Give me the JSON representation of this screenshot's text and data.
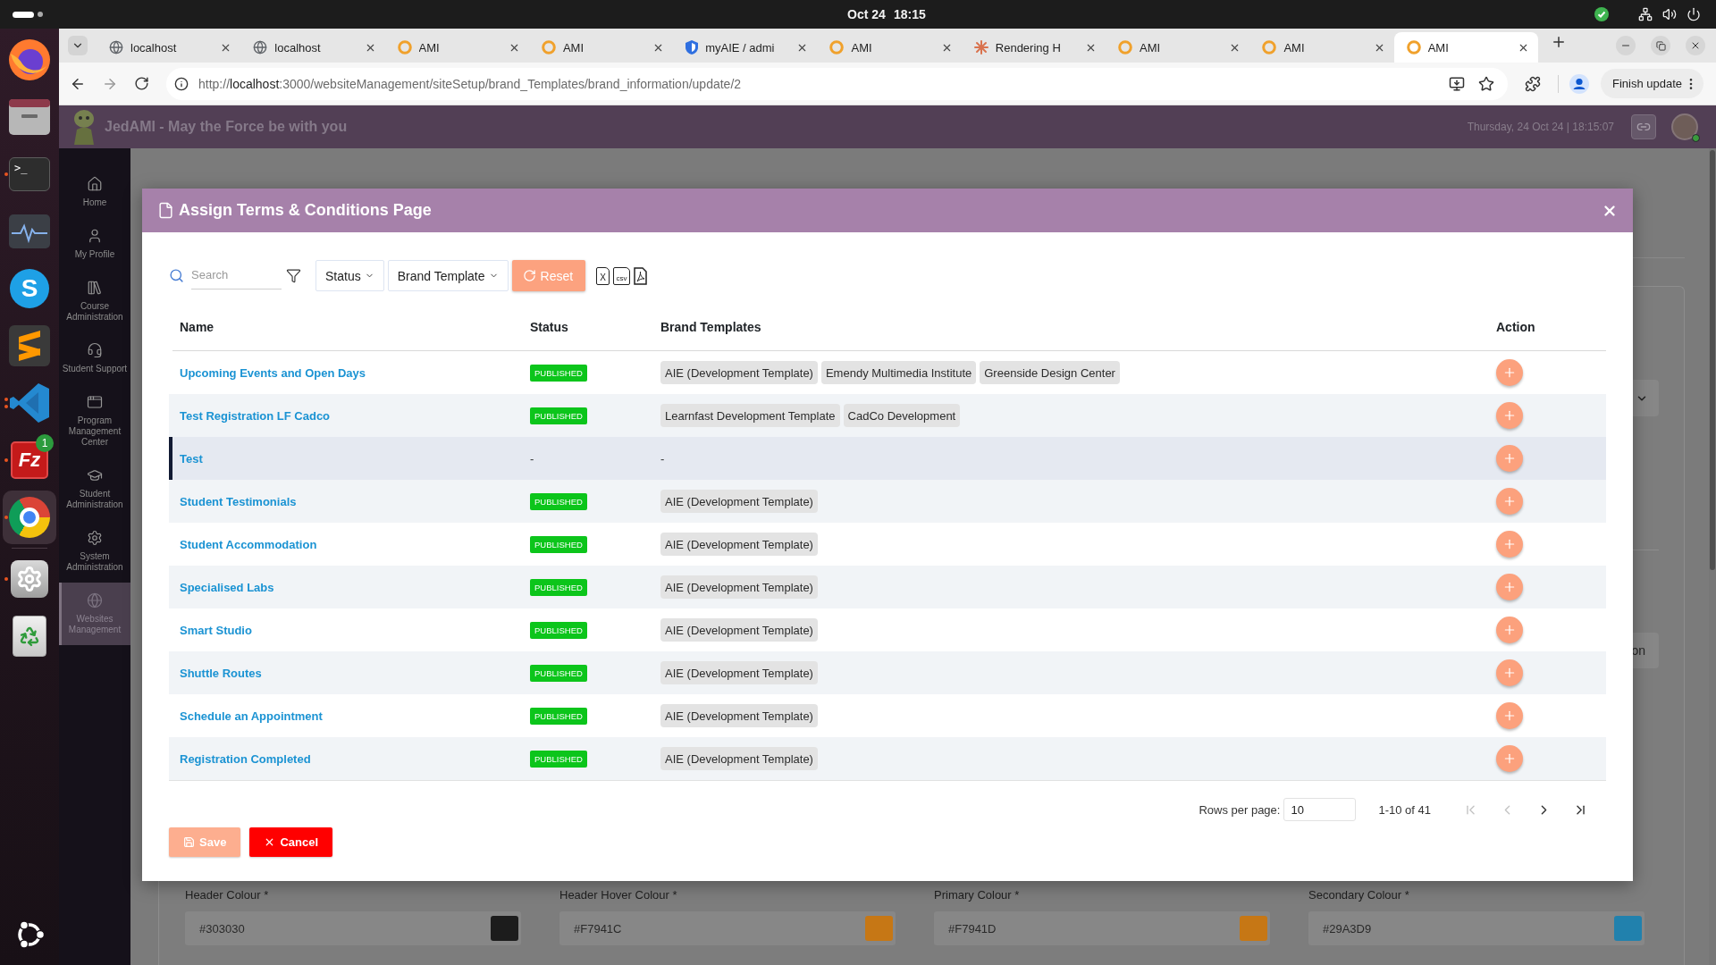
{
  "system_bar": {
    "date": "Oct 24",
    "time": "18:15"
  },
  "dock": {
    "apps": [
      {
        "running": false,
        "multi_window": false,
        "selected": false
      },
      {
        "running": false,
        "multi_window": false,
        "selected": false
      },
      {
        "glyph": ">_",
        "running": true,
        "multi_window": false,
        "selected": false
      },
      {
        "running": false,
        "multi_window": false,
        "selected": false
      },
      {
        "glyph": "S",
        "running": false,
        "multi_window": false,
        "selected": false
      },
      {
        "running": false,
        "multi_window": false,
        "selected": false
      },
      {
        "running": true,
        "multi_window": true,
        "selected": false
      },
      {
        "glyph": "Fz",
        "badge": "1",
        "running": true,
        "multi_window": false,
        "selected": false
      },
      {
        "running": true,
        "multi_window": false,
        "selected": true
      },
      {
        "running": true,
        "multi_window": false,
        "selected": false
      },
      {
        "running": false,
        "multi_window": false,
        "selected": false
      }
    ]
  },
  "browser": {
    "tabs": [
      {
        "title": "localhost",
        "selected": false
      },
      {
        "title": "localhost",
        "selected": false
      },
      {
        "title": "AMI",
        "selected": false
      },
      {
        "title": "AMI",
        "selected": false
      },
      {
        "title": "myAIE / admi",
        "selected": false
      },
      {
        "title": "AMI",
        "selected": false
      },
      {
        "title": "Rendering H",
        "selected": false
      },
      {
        "title": "AMI",
        "selected": false
      },
      {
        "title": "AMI",
        "selected": false
      },
      {
        "title": "AMI",
        "selected": true
      }
    ],
    "url": {
      "scheme": "http://",
      "host": "localhost",
      "path": ":3000/websiteManagement/siteSetup/brand_Templates/brand_information/update/2"
    },
    "update_button": "Finish update"
  },
  "app_header": {
    "title": "JedAMI - May the Force be with you",
    "datetime": "Thursday, 24 Oct 24 | 18:15:07"
  },
  "sidebar": {
    "items": [
      {
        "label": "Home",
        "selected": false
      },
      {
        "label": "My Profile",
        "selected": false
      },
      {
        "label": "Course Administration",
        "selected": false
      },
      {
        "label": "Student Support",
        "selected": false
      },
      {
        "label": "Program Management Center",
        "selected": false
      },
      {
        "label": "Student Administration",
        "selected": false
      },
      {
        "label": "System Administration",
        "selected": false
      },
      {
        "label": "Websites Management",
        "selected": true
      }
    ]
  },
  "dialog": {
    "title": "Assign Terms & Conditions Page",
    "toolbar": {
      "search": {
        "placeholder": "Search"
      },
      "filters": [
        "Status",
        "Brand Template"
      ],
      "reset": "Reset",
      "exports": [
        {
          "kind": "xls",
          "glyph": "X"
        },
        {
          "kind": "csv",
          "glyph": "csv"
        },
        {
          "kind": "pdf"
        }
      ]
    },
    "table": {
      "columns": [
        "Name",
        "Status",
        "Brand Templates",
        "Action"
      ],
      "rows": [
        {
          "name": "Upcoming Events and Open Days",
          "status": {
            "kind": "badge",
            "text": "PUBLISHED"
          },
          "brand_templates": {
            "kind": "chips",
            "items": [
              "AIE (Development Template)",
              "Emendy Multimedia Institute",
              "Greenside Design Center"
            ]
          },
          "selected": false
        },
        {
          "name": "Test Registration LF Cadco",
          "status": {
            "kind": "badge",
            "text": "PUBLISHED"
          },
          "brand_templates": {
            "kind": "chips",
            "items": [
              "Learnfast Development Template",
              "CadCo Development"
            ]
          },
          "selected": false
        },
        {
          "name": "Test",
          "status": {
            "kind": "text",
            "text": "-"
          },
          "brand_templates": {
            "kind": "text",
            "text": "-"
          },
          "selected": true
        },
        {
          "name": "Student Testimonials",
          "status": {
            "kind": "badge",
            "text": "PUBLISHED"
          },
          "brand_templates": {
            "kind": "chips",
            "items": [
              "AIE (Development Template)"
            ]
          },
          "selected": false
        },
        {
          "name": "Student Accommodation",
          "status": {
            "kind": "badge",
            "text": "PUBLISHED"
          },
          "brand_templates": {
            "kind": "chips",
            "items": [
              "AIE (Development Template)"
            ]
          },
          "selected": false
        },
        {
          "name": "Specialised Labs",
          "status": {
            "kind": "badge",
            "text": "PUBLISHED"
          },
          "brand_templates": {
            "kind": "chips",
            "items": [
              "AIE (Development Template)"
            ]
          },
          "selected": false
        },
        {
          "name": "Smart Studio",
          "status": {
            "kind": "badge",
            "text": "PUBLISHED"
          },
          "brand_templates": {
            "kind": "chips",
            "items": [
              "AIE (Development Template)"
            ]
          },
          "selected": false
        },
        {
          "name": "Shuttle Routes",
          "status": {
            "kind": "badge",
            "text": "PUBLISHED"
          },
          "brand_templates": {
            "kind": "chips",
            "items": [
              "AIE (Development Template)"
            ]
          },
          "selected": false
        },
        {
          "name": "Schedule an Appointment",
          "status": {
            "kind": "badge",
            "text": "PUBLISHED"
          },
          "brand_templates": {
            "kind": "chips",
            "items": [
              "AIE (Development Template)"
            ]
          },
          "selected": false
        },
        {
          "name": "Registration Completed",
          "status": {
            "kind": "badge",
            "text": "PUBLISHED"
          },
          "brand_templates": {
            "kind": "chips",
            "items": [
              "AIE (Development Template)"
            ]
          },
          "selected": false
        }
      ]
    },
    "pagination": {
      "rows_per_page_label": "Rows per page:",
      "rows_per_page": "10",
      "range": "1-10 of 41",
      "nav": [
        {
          "kind": "first",
          "disabled": true
        },
        {
          "kind": "prev",
          "disabled": true
        },
        {
          "kind": "next",
          "disabled": false
        },
        {
          "kind": "last",
          "disabled": false
        }
      ]
    },
    "buttons": [
      {
        "kind": "save",
        "label": "Save",
        "disabled": true
      },
      {
        "kind": "cancel",
        "label": "Cancel",
        "disabled": false
      }
    ]
  },
  "page": {
    "partial_button": "on",
    "colour_fields": [
      {
        "label": "Header Colour *",
        "value": "#303030",
        "color": "#1c1c1c"
      },
      {
        "label": "Header Hover Colour *",
        "value": "#F7941C",
        "color": "#c67715"
      },
      {
        "label": "Primary Colour *",
        "value": "#F7941D",
        "color": "#c67715"
      },
      {
        "label": "Secondary Colour *",
        "value": "#29A3D9",
        "color": "#2181ad"
      }
    ]
  }
}
